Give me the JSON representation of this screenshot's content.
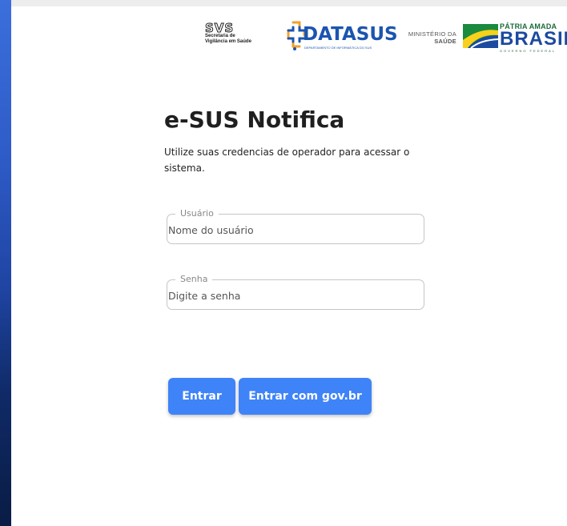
{
  "header": {
    "svs": {
      "mark": "SVS",
      "caption": "Secretaria de\nVigilância em Saúde"
    },
    "datasus": {
      "word": "DATASUS",
      "caption": "DEPARTAMENTO DE INFORMÁTICA DO SUS"
    },
    "ministerio": {
      "line1": "MINISTÉRIO DA",
      "line2": "SAÚDE"
    },
    "gov_brand": {
      "top": "PÁTRIA AMADA",
      "main": "BRASIL",
      "bottom": "GOVERNO FEDERAL"
    }
  },
  "login": {
    "title": "e-SUS Notifica",
    "subtitle": "Utilize suas credencias de operador para acessar o sistema.",
    "username": {
      "label": "Usuário",
      "placeholder": "Nome do usuário",
      "value": ""
    },
    "password": {
      "label": "Senha",
      "placeholder": "Digite a senha",
      "value": ""
    },
    "buttons": {
      "login": "Entrar",
      "login_gov": "Entrar com gov.br"
    }
  },
  "colors": {
    "accent": "#3f83f8",
    "sidebar_gradient_top": "#3b6fdc",
    "sidebar_gradient_bottom": "#0a1c44",
    "datasus_blue": "#1b55b0",
    "brasil_blue": "#1b4aa0",
    "brasil_green": "#1a6b3a"
  }
}
